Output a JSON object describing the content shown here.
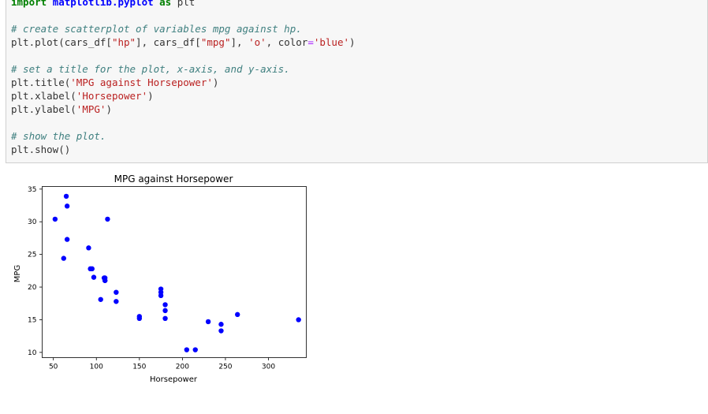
{
  "code": {
    "lines": [
      {
        "segments": [
          [
            "kw",
            "import"
          ],
          [
            "plain",
            " "
          ],
          [
            "mod",
            "matplotlib.pyplot"
          ],
          [
            "plain",
            " "
          ],
          [
            "kw",
            "as"
          ],
          [
            "plain",
            " plt"
          ]
        ]
      },
      {
        "segments": []
      },
      {
        "segments": [
          [
            "com",
            "# create scatterplot of variables mpg against hp."
          ]
        ]
      },
      {
        "segments": [
          [
            "plain",
            "plt.plot(cars_df["
          ],
          [
            "str",
            "\"hp\""
          ],
          [
            "plain",
            "], cars_df["
          ],
          [
            "str",
            "\"mpg\""
          ],
          [
            "plain",
            "], "
          ],
          [
            "str",
            "'o'"
          ],
          [
            "plain",
            ", color"
          ],
          [
            "op",
            "="
          ],
          [
            "str",
            "'blue'"
          ],
          [
            "plain",
            ")"
          ]
        ]
      },
      {
        "segments": []
      },
      {
        "segments": [
          [
            "com",
            "# set a title for the plot, x-axis, and y-axis."
          ]
        ]
      },
      {
        "segments": [
          [
            "plain",
            "plt.title("
          ],
          [
            "str",
            "'MPG against Horsepower'"
          ],
          [
            "plain",
            ")"
          ]
        ]
      },
      {
        "segments": [
          [
            "plain",
            "plt.xlabel("
          ],
          [
            "str",
            "'Horsepower'"
          ],
          [
            "plain",
            ")"
          ]
        ]
      },
      {
        "segments": [
          [
            "plain",
            "plt.ylabel("
          ],
          [
            "str",
            "'MPG'"
          ],
          [
            "plain",
            ")"
          ]
        ]
      },
      {
        "segments": []
      },
      {
        "segments": [
          [
            "com",
            "# show the plot."
          ]
        ]
      },
      {
        "segments": [
          [
            "plain",
            "plt.show()"
          ]
        ]
      }
    ]
  },
  "chart_data": {
    "type": "scatter",
    "title": "MPG against Horsepower",
    "xlabel": "Horsepower",
    "ylabel": "MPG",
    "xlim": [
      37,
      344
    ],
    "ylim": [
      9.2,
      35.4
    ],
    "xticks": [
      50,
      100,
      150,
      200,
      250,
      300
    ],
    "yticks": [
      10,
      15,
      20,
      25,
      30,
      35
    ],
    "marker_color": "#0000ff",
    "grid": false,
    "points": [
      [
        110,
        21.0
      ],
      [
        110,
        21.0
      ],
      [
        93,
        22.8
      ],
      [
        110,
        21.4
      ],
      [
        175,
        18.7
      ],
      [
        105,
        18.1
      ],
      [
        245,
        14.3
      ],
      [
        62,
        24.4
      ],
      [
        95,
        22.8
      ],
      [
        123,
        19.2
      ],
      [
        123,
        17.8
      ],
      [
        180,
        16.4
      ],
      [
        180,
        17.3
      ],
      [
        180,
        15.2
      ],
      [
        205,
        10.4
      ],
      [
        215,
        10.4
      ],
      [
        230,
        14.7
      ],
      [
        66,
        32.4
      ],
      [
        52,
        30.4
      ],
      [
        65,
        33.9
      ],
      [
        97,
        21.5
      ],
      [
        150,
        15.5
      ],
      [
        150,
        15.2
      ],
      [
        245,
        13.3
      ],
      [
        175,
        19.2
      ],
      [
        66,
        27.3
      ],
      [
        91,
        26.0
      ],
      [
        113,
        30.4
      ],
      [
        264,
        15.8
      ],
      [
        175,
        19.7
      ],
      [
        335,
        15.0
      ],
      [
        109,
        21.4
      ]
    ]
  }
}
